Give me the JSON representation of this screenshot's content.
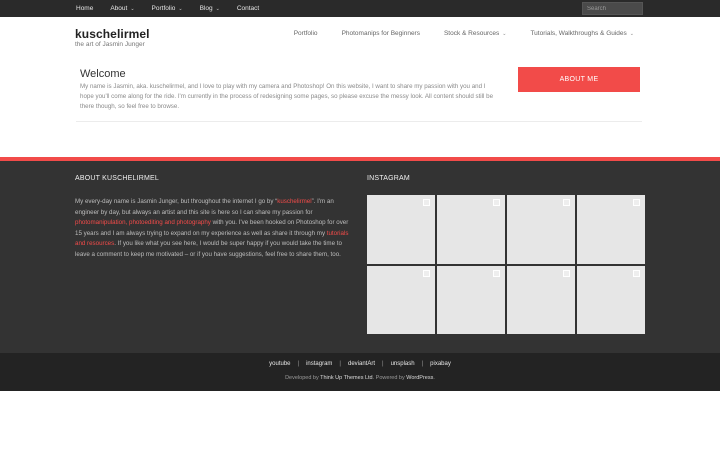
{
  "topbar": {
    "nav": [
      {
        "label": "Home",
        "dropdown": false
      },
      {
        "label": "About",
        "dropdown": true
      },
      {
        "label": "Portfolio",
        "dropdown": true
      },
      {
        "label": "Blog",
        "dropdown": true
      },
      {
        "label": "Contact",
        "dropdown": false
      }
    ],
    "search_placeholder": "Search"
  },
  "header": {
    "site_title": "kuschelirmel",
    "tagline": "the art of Jasmin Junger",
    "nav": [
      {
        "label": "Portfolio",
        "dropdown": false
      },
      {
        "label": "Photomanips for Beginners",
        "dropdown": false
      },
      {
        "label": "Stock & Resources",
        "dropdown": true
      },
      {
        "label": "Tutorials, Walkthroughs & Guides",
        "dropdown": true
      }
    ]
  },
  "welcome": {
    "title": "Welcome",
    "text": "My name is Jasmin, aka. kuschelirmel, and I love to play with my camera and Photoshop! On this website, I want to share my passion with you and I hope you'll come along for the ride. I'm currently in the process of redesigning some pages, so please excuse the messy look. All content should still be there though, so feel free to browse.",
    "button_label": "ABOUT ME"
  },
  "footer_about": {
    "title": "ABOUT KUSCHELIRMEL",
    "p1": "My every-day name is Jasmin Junger, but throughout the internet I go by “",
    "link1": "kuschelirmel",
    "p2": "”. I'm an engineer by day, but always an artist and this site is here so I can share my passion for ",
    "link2": "photomanipulation, photoediting and photography",
    "p3": " with you. I've been hooked on Photoshop for over 15 years and I am always trying to expand on my experience as well as share it through my ",
    "link3": "tutorials and resources",
    "p4": ". If you like what you see here, I would be super happy if you would take the time to leave a comment to keep me motivated – or if you have suggestions, feel free to share them, too."
  },
  "footer_instagram": {
    "title": "INSTAGRAM",
    "tile_count": 8
  },
  "bottom": {
    "links": [
      "youtube",
      "instagram",
      "deviantArt",
      "unsplash",
      "pixabay"
    ],
    "credit_pre": "Developed by ",
    "credit_dev": "Think Up Themes Ltd",
    "credit_mid": ". Powered by ",
    "credit_wp": "WordPress",
    "credit_end": "."
  },
  "colors": {
    "accent": "#f24b49",
    "topbar": "#2a2a2a",
    "footer": "#333333",
    "bottombar": "#232323"
  }
}
